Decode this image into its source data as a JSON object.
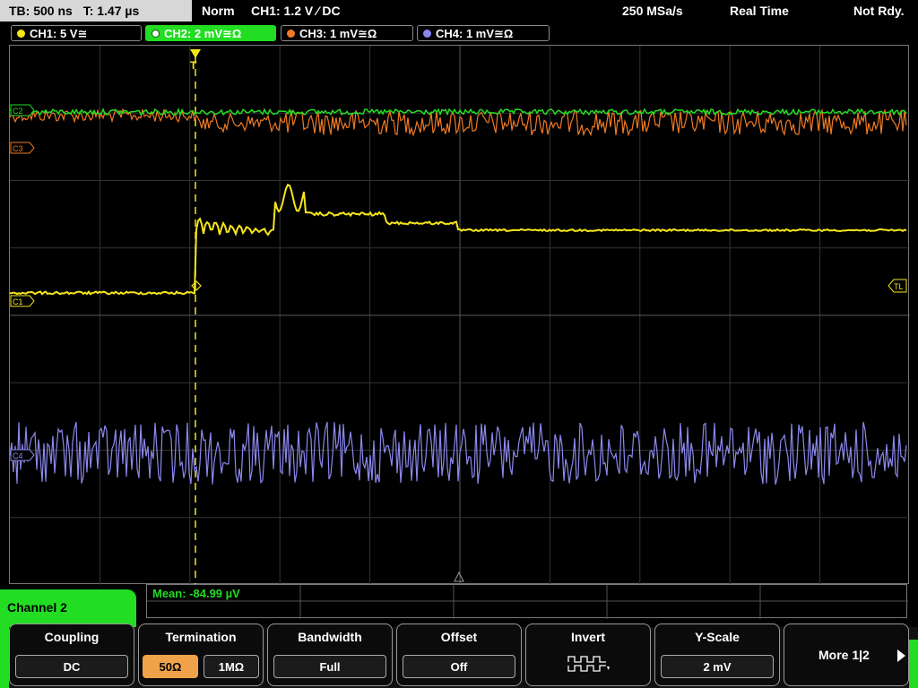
{
  "status": {
    "timebase": "TB: 500 ns",
    "trigger_time": "T: 1.47 µs",
    "mode": "Norm",
    "trigger": "CH1: 1.2 V ⁄ DC",
    "sample_rate": "250 MSa/s",
    "acq_mode": "Real Time",
    "state": "Not Rdy."
  },
  "channels": [
    {
      "label": "CH1: 5 V≅",
      "color": "#f5e61a"
    },
    {
      "label": "CH2: 2 mV≅Ω",
      "color": "#22dd22"
    },
    {
      "label": "CH3: 1 mV≅Ω",
      "color": "#f07a24"
    },
    {
      "label": "CH4: 1 mV≅Ω",
      "color": "#8c88ee"
    }
  ],
  "markers": {
    "c3": "C3",
    "c1": "C1",
    "c2": "C2",
    "c4": "C4",
    "trigger_level": "TL"
  },
  "measurement": {
    "mean": "Mean: -84.99 µV"
  },
  "menu": {
    "title": "Channel 2"
  },
  "softkeys": {
    "coupling": {
      "title": "Coupling",
      "value": "DC"
    },
    "termination": {
      "title": "Termination",
      "option_a": "50Ω",
      "option_b": "1MΩ"
    },
    "bandwidth": {
      "title": "Bandwidth",
      "value": "Full"
    },
    "offset": {
      "title": "Offset",
      "value": "Off"
    },
    "invert": {
      "title": "Invert",
      "icon": "invert-waveform-icon"
    },
    "yscale": {
      "title": "Y-Scale",
      "value": "2 mV"
    },
    "more": {
      "label": "More 1|2",
      "icon": "arrow-right-icon"
    }
  }
}
